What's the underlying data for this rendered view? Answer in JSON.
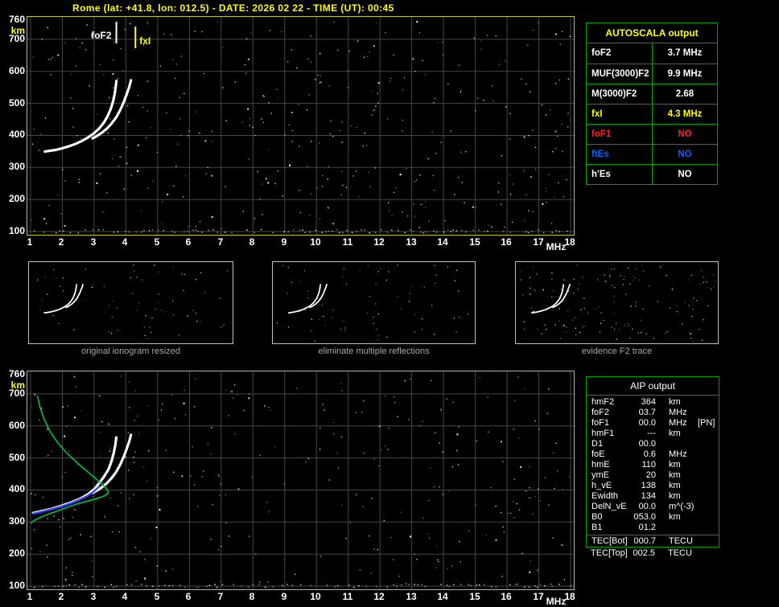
{
  "title": "Rome (lat: +41.8, lon: 012.5) - DATE: 2026 02 22 - TIME (UT): 00:45",
  "colors": {
    "background": "#000000",
    "title_text": "#ffff00",
    "plot_border": "#c8c800",
    "grid_line": "#464646",
    "axis_tick_text": "#ffffff",
    "km_label": "#ffff00",
    "mhz_label": "#ffffff",
    "trace_white": "#ffffff",
    "profile_green": "#00bb44",
    "restored_blue": "#3344ff",
    "table_border_green": "#00a000",
    "caption_text": "#a8a8a8",
    "value_red": "#ff2222",
    "value_blue": "#0066ff",
    "value_yellow": "#ffff00"
  },
  "autoscala_table": {
    "title": "AUTOSCALA output",
    "rows": [
      {
        "param": "foF2",
        "value": "3.7 MHz",
        "color": "#ffffff"
      },
      {
        "param": "MUF(3000)F2",
        "value": "9.9 MHz",
        "color": "#ffffff"
      },
      {
        "param": "M(3000)F2",
        "value": "2.68",
        "color": "#ffffff"
      },
      {
        "param": "fxI",
        "value": "4.3 MHz",
        "color": "#ffff00"
      },
      {
        "param": "foF1",
        "value": "NO",
        "color": "#ff2222"
      },
      {
        "param": "ftEs",
        "value": "NO",
        "color": "#0066ff"
      },
      {
        "param": "h'Es",
        "value": "NO",
        "color": "#ffffff"
      }
    ]
  },
  "aip_table": {
    "title": "AIP output",
    "rows": [
      {
        "param": "hmF2",
        "value": "364",
        "unit": "km",
        "note": ""
      },
      {
        "param": "foF2",
        "value": "03.7",
        "unit": "MHz",
        "note": ""
      },
      {
        "param": "foF1",
        "value": "00.0",
        "unit": "MHz",
        "note": "[PN]"
      },
      {
        "param": "hmF1",
        "value": "---",
        "unit": "km",
        "note": ""
      },
      {
        "param": "D1",
        "value": "00.0",
        "unit": "",
        "note": ""
      },
      {
        "param": "foE",
        "value": "0.6",
        "unit": "MHz",
        "note": ""
      },
      {
        "param": "hmE",
        "value": "110",
        "unit": "km",
        "note": ""
      },
      {
        "param": "ymE",
        "value": "20",
        "unit": "km",
        "note": ""
      },
      {
        "param": "h_vE",
        "value": "138",
        "unit": "km",
        "note": ""
      },
      {
        "param": "Ewidth",
        "value": "134",
        "unit": "km",
        "note": ""
      },
      {
        "param": "DelN_vE",
        "value": "00.0",
        "unit": "m^(-3)",
        "note": ""
      },
      {
        "param": "B0",
        "value": "053.0",
        "unit": "km",
        "note": ""
      },
      {
        "param": "B1",
        "value": "01.2",
        "unit": "",
        "note": ""
      }
    ],
    "tec_rows": [
      {
        "param": "TEC[Bot]",
        "value": "000.7",
        "unit": "TECU",
        "note": ""
      },
      {
        "param": "TEC[Top]",
        "value": "002.5",
        "unit": "TECU",
        "note": ""
      }
    ]
  },
  "thumbnails": [
    {
      "caption": "original ionogram resized"
    },
    {
      "caption": "eliminate multiple reflections"
    },
    {
      "caption": "evidence F2 trace"
    }
  ],
  "chart_data": [
    {
      "id": "scaled-ionogram",
      "type": "scatter",
      "title": "autoscaled ionogram",
      "xlabel": "MHz",
      "ylabel": "km",
      "xlim": [
        1,
        18
      ],
      "ylim": [
        100,
        760
      ],
      "xticks": [
        1,
        2,
        3,
        4,
        5,
        6,
        7,
        8,
        9,
        10,
        11,
        12,
        13,
        14,
        15,
        16,
        17,
        18
      ],
      "yticks": [
        760,
        700,
        600,
        500,
        400,
        300,
        200,
        100
      ],
      "grid": true,
      "markers": [
        {
          "label": "foF2",
          "x": 3.7,
          "color": "#ffffff",
          "side": "left"
        },
        {
          "label": "fxI",
          "x": 4.3,
          "color": "#ffff00",
          "side": "right"
        }
      ],
      "series": [
        {
          "name": "F2 ordinary trace",
          "color": "#ffffff",
          "style": "dotted-thick",
          "points": [
            [
              1.45,
              350
            ],
            [
              1.6,
              352
            ],
            [
              1.8,
              355
            ],
            [
              2.0,
              360
            ],
            [
              2.2,
              366
            ],
            [
              2.4,
              373
            ],
            [
              2.6,
              382
            ],
            [
              2.8,
              393
            ],
            [
              3.0,
              407
            ],
            [
              3.15,
              421
            ],
            [
              3.3,
              439
            ],
            [
              3.42,
              459
            ],
            [
              3.52,
              482
            ],
            [
              3.6,
              507
            ],
            [
              3.65,
              531
            ],
            [
              3.68,
              552
            ],
            [
              3.7,
              570
            ]
          ]
        },
        {
          "name": "F2 extraordinary trace",
          "color": "#ffffff",
          "style": "dotted-thick",
          "points": [
            [
              2.95,
              391
            ],
            [
              3.1,
              399
            ],
            [
              3.25,
              409
            ],
            [
              3.4,
              421
            ],
            [
              3.55,
              437
            ],
            [
              3.7,
              457
            ],
            [
              3.82,
              479
            ],
            [
              3.93,
              503
            ],
            [
              4.02,
              527
            ],
            [
              4.1,
              550
            ],
            [
              4.16,
              572
            ]
          ]
        }
      ]
    },
    {
      "id": "profile-ionogram",
      "type": "scatter",
      "title": "restored trace and electron density profile",
      "xlabel": "MHz",
      "ylabel": "km",
      "xlim": [
        1,
        18
      ],
      "ylim": [
        100,
        760
      ],
      "xticks": [
        1,
        2,
        3,
        4,
        5,
        6,
        7,
        8,
        9,
        10,
        11,
        12,
        13,
        14,
        15,
        16,
        17,
        18
      ],
      "yticks": [
        760,
        700,
        600,
        500,
        400,
        300,
        200,
        100
      ],
      "grid": true,
      "markers": [],
      "series": [
        {
          "name": "restored F2 ordinary trace",
          "color": "#ffffff",
          "style": "dotted-thick",
          "points": [
            [
              1.08,
              328
            ],
            [
              1.35,
              334
            ],
            [
              1.65,
              341
            ],
            [
              1.95,
              350
            ],
            [
              2.25,
              360
            ],
            [
              2.55,
              372
            ],
            [
              2.8,
              386
            ],
            [
              3.0,
              402
            ],
            [
              3.15,
              420
            ],
            [
              3.3,
              440
            ],
            [
              3.45,
              464
            ],
            [
              3.55,
              490
            ],
            [
              3.62,
              516
            ],
            [
              3.67,
              542
            ],
            [
              3.7,
              566
            ]
          ]
        },
        {
          "name": "F2 extraordinary trace",
          "color": "#ffffff",
          "style": "dotted-thick",
          "points": [
            [
              2.95,
              391
            ],
            [
              3.1,
              399
            ],
            [
              3.25,
              409
            ],
            [
              3.4,
              421
            ],
            [
              3.55,
              437
            ],
            [
              3.7,
              457
            ],
            [
              3.82,
              479
            ],
            [
              3.93,
              503
            ],
            [
              4.02,
              527
            ],
            [
              4.1,
              550
            ],
            [
              4.16,
              572
            ]
          ]
        },
        {
          "name": "adjusted low-frequency trace",
          "color": "#3344ff",
          "style": "dotted",
          "points": [
            [
              1.08,
              326
            ],
            [
              1.35,
              332
            ],
            [
              1.65,
              340
            ],
            [
              1.95,
              348
            ],
            [
              2.25,
              358
            ],
            [
              2.55,
              370
            ],
            [
              2.8,
              382
            ],
            [
              3.0,
              396
            ],
            [
              3.15,
              410
            ]
          ]
        },
        {
          "name": "electron density profile",
          "color": "#00bb44",
          "style": "solid",
          "points": [
            [
              1.02,
              298
            ],
            [
              1.12,
              305
            ],
            [
              1.3,
              314
            ],
            [
              1.55,
              324
            ],
            [
              1.85,
              335
            ],
            [
              2.15,
              346
            ],
            [
              2.45,
              356
            ],
            [
              2.75,
              364
            ],
            [
              3.0,
              371
            ],
            [
              3.2,
              377
            ],
            [
              3.33,
              382
            ],
            [
              3.42,
              388
            ],
            [
              3.44,
              394
            ],
            [
              3.4,
              403
            ],
            [
              3.28,
              416
            ],
            [
              3.08,
              433
            ],
            [
              2.82,
              455
            ],
            [
              2.5,
              482
            ],
            [
              2.15,
              514
            ],
            [
              1.85,
              548
            ],
            [
              1.6,
              585
            ],
            [
              1.42,
              622
            ],
            [
              1.3,
              658
            ],
            [
              1.22,
              692
            ]
          ]
        }
      ]
    }
  ]
}
